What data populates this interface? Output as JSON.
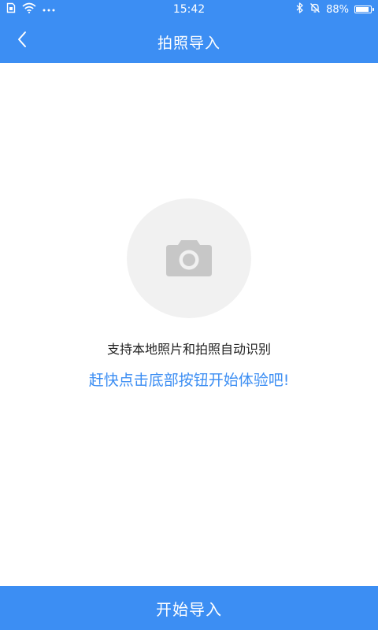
{
  "colors": {
    "accent": "#3c8ef3",
    "circle_bg": "#f1f1f1",
    "camera_icon": "#c7c7c7",
    "primary_text": "#222222"
  },
  "status_bar": {
    "time": "15:42",
    "battery_text": "88%",
    "battery_level": 0.88,
    "left_icons": [
      "sim-card-icon",
      "wifi-icon",
      "more-dots-icon"
    ],
    "right_icons": [
      "bluetooth-icon",
      "mute-bell-icon",
      "battery-icon"
    ]
  },
  "header": {
    "title": "拍照导入",
    "back_icon": "chevron-left-icon"
  },
  "main": {
    "camera_icon": "camera-icon",
    "hint_primary": "支持本地照片和拍照自动识别",
    "hint_secondary": "赶快点击底部按钮开始体验吧!"
  },
  "footer": {
    "button_label": "开始导入"
  }
}
